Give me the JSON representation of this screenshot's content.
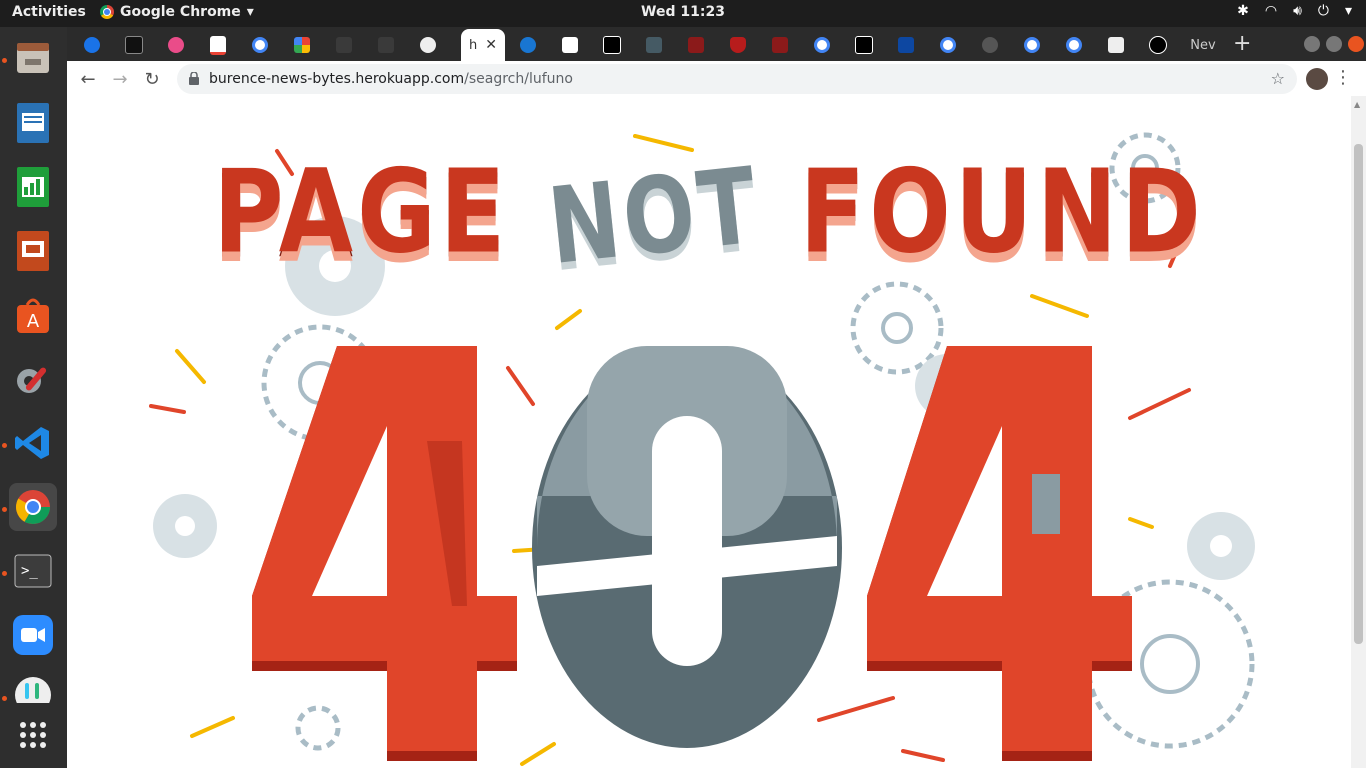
{
  "system": {
    "activities": "Activities",
    "app_name": "Google Chrome",
    "clock": "Wed 11:23"
  },
  "browser": {
    "active_tab_label": "h",
    "last_tab_label": "Nev",
    "url_host": "burence-news-bytes.herokuapp.com",
    "url_path": "/seagrch/lufuno"
  },
  "page": {
    "headline_word1": "PAGE",
    "headline_word2": "NOT",
    "headline_word3": "FOUND",
    "digit_left": "4",
    "digit_right": "4"
  },
  "colors": {
    "accent_red": "#c9371f",
    "gear_gray": "#7b8b91",
    "dash_yellow": "#f5b800",
    "ubuntu_orange": "#e95420"
  }
}
